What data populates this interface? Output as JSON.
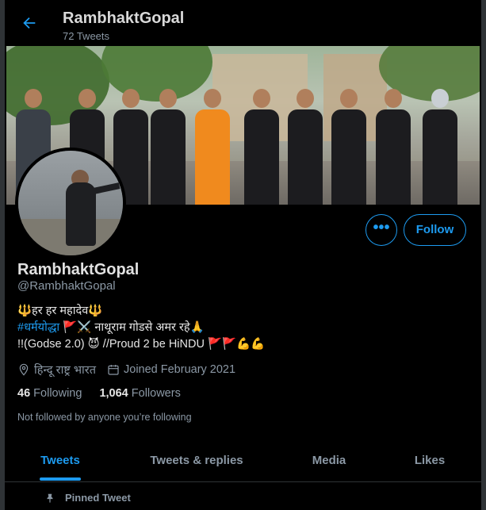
{
  "header": {
    "title": "RambhaktGopal",
    "tweet_count": "72 Tweets"
  },
  "profile": {
    "display_name": "RambhaktGopal",
    "handle": "@RambhaktGopal",
    "bio_line1": "🔱हर हर महादेव🔱",
    "bio_line2_tag": "#धर्मयोद्धा",
    "bio_line2_rest": " 🚩⚔️ नाथूराम गोडसे अमर रहे🙏",
    "bio_line3": "!!(Godse 2.0) 😈   //Proud 2 be HiNDU 🚩🚩💪💪",
    "location": "हिन्दू राष्ट्र भारत",
    "joined": "Joined February 2021",
    "following_count": "46",
    "following_label": "Following",
    "followers_count": "1,064",
    "followers_label": "Followers",
    "not_followed": "Not followed by anyone you’re following",
    "more_label": "•••",
    "follow_label": "Follow"
  },
  "tabs": [
    {
      "label": "Tweets",
      "active": true
    },
    {
      "label": "Tweets & replies",
      "active": false
    },
    {
      "label": "Media",
      "active": false
    },
    {
      "label": "Likes",
      "active": false
    }
  ],
  "pinned_label": "Pinned Tweet",
  "colors": {
    "accent": "#1d9bf0",
    "background": "#000000",
    "muted": "#8b98a5"
  }
}
